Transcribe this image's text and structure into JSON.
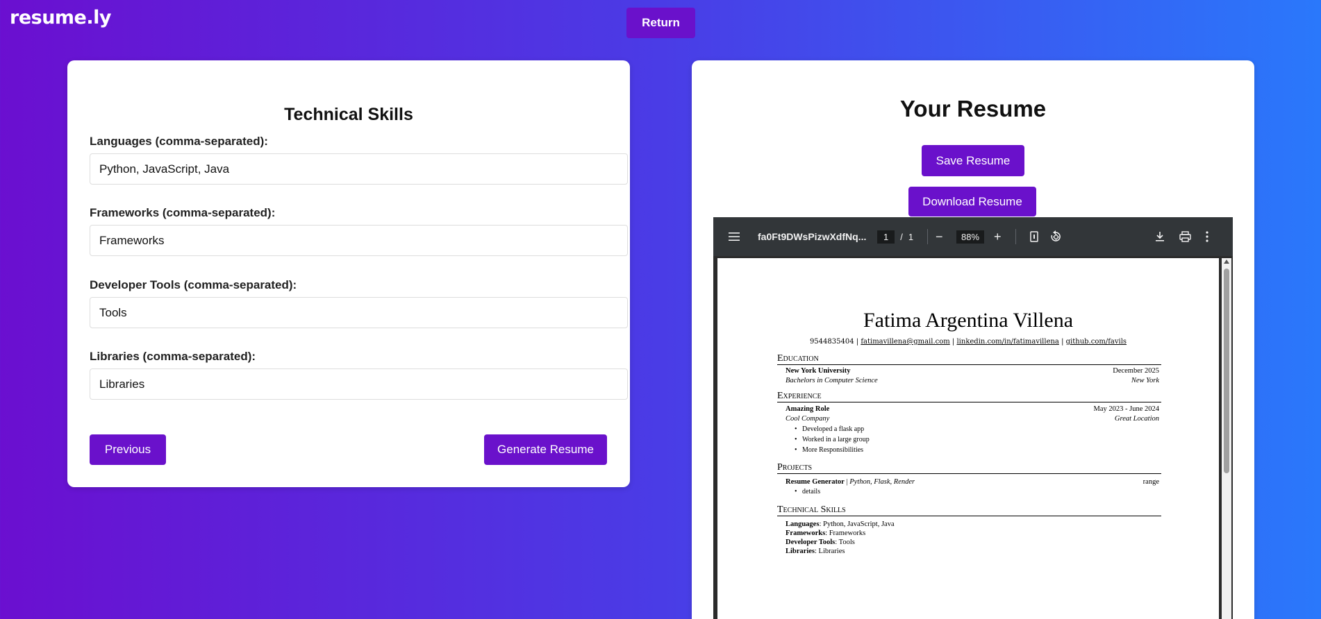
{
  "app": {
    "logo": "resume.ly",
    "return_label": "Return"
  },
  "form": {
    "title": "Technical Skills",
    "fields": [
      {
        "label": "Languages (comma-separated):",
        "value": "Python, JavaScript, Java"
      },
      {
        "label": "Frameworks (comma-separated):",
        "value": "Frameworks"
      },
      {
        "label": "Developer Tools (comma-separated):",
        "value": "Tools"
      },
      {
        "label": "Libraries (comma-separated):",
        "value": "Libraries"
      }
    ],
    "previous_label": "Previous",
    "generate_label": "Generate Resume"
  },
  "preview": {
    "title": "Your Resume",
    "save_label": "Save Resume",
    "download_label": "Download Resume"
  },
  "pdf_viewer": {
    "filename": "fa0Ft9DWsPizwXdfNq...",
    "current_page": "1",
    "page_separator": "/",
    "total_pages": "1",
    "zoom": "88%",
    "zoom_out": "−",
    "zoom_in": "+"
  },
  "resume": {
    "name": "Fatima Argentina Villena",
    "contact": {
      "phone": "9544835404",
      "email": "fatimavillena@gmail.com",
      "linkedin": "linkedin.com/in/fatimavillena",
      "github": "github.com/favils",
      "separator": "|"
    },
    "sections": {
      "education": "Education",
      "experience": "Experience",
      "projects": "Projects",
      "skills": "Technical Skills"
    },
    "education": {
      "school": "New York University",
      "date": "December 2025",
      "degree": "Bachelors in Computer Science",
      "location": "New York"
    },
    "experience": {
      "role": "Amazing Role",
      "dates": "May 2023 - June 2024",
      "company": "Cool Company",
      "location": "Great Location",
      "bullets": [
        "Developed a flask app",
        "Worked in a large group",
        "More Responsibilities"
      ]
    },
    "project": {
      "name": "Resume Generator",
      "separator": "|",
      "tech": "Python, Flask, Render",
      "range": "range",
      "bullets": [
        "details"
      ]
    },
    "skills": [
      {
        "label": "Languages",
        "value": ": Python, JavaScript, Java"
      },
      {
        "label": "Frameworks",
        "value": ": Frameworks"
      },
      {
        "label": "Developer Tools",
        "value": ": Tools"
      },
      {
        "label": "Libraries",
        "value": ": Libraries"
      }
    ]
  },
  "colors": {
    "accent": "#6a11cb",
    "gradient_start": "#6b0fd0",
    "gradient_end": "#2a78fb",
    "toolbar": "#323639"
  },
  "icons": [
    "menu-icon",
    "fit-page-icon",
    "rotate-icon",
    "download-icon",
    "print-icon",
    "more-vert-icon"
  ]
}
